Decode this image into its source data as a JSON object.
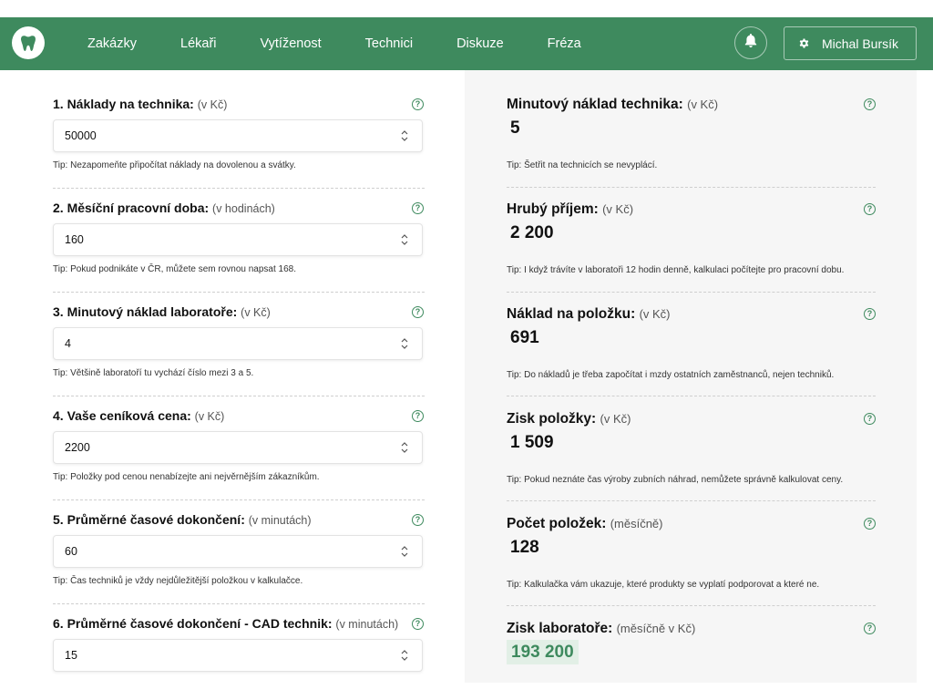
{
  "nav": {
    "items": [
      "Zakázky",
      "Lékaři",
      "Vytíženost",
      "Technici",
      "Diskuze",
      "Fréza"
    ],
    "user_name": "Michal Bursík",
    "accent": "#3e8a5e"
  },
  "tip_prefix": "Tip:",
  "help_glyph": "?",
  "inputs": [
    {
      "label": "1. Náklady na technika:",
      "unit": "(v Kč)",
      "value": "50000",
      "tip": "Nezapomeňte připočítat náklady na dovolenou a svátky."
    },
    {
      "label": "2. Měsíční pracovní doba:",
      "unit": "(v hodinách)",
      "value": "160",
      "tip": "Pokud podnikáte v ČR, můžete sem rovnou napsat 168."
    },
    {
      "label": "3. Minutový náklad laboratoře:",
      "unit": "(v Kč)",
      "value": "4",
      "tip": "Většině laboratoří tu vychází číslo mezi 3 a 5."
    },
    {
      "label": "4. Vaše ceníková cena:",
      "unit": "(v Kč)",
      "value": "2200",
      "tip": "Položky pod cenou nenabízejte ani nejvěrnějším zákazníkům."
    },
    {
      "label": "5. Průměrné časové dokončení:",
      "unit": "(v minutách)",
      "value": "60",
      "tip": "Čas techniků je vždy nejdůležitější položkou v kalkulačce."
    },
    {
      "label": "6. Průměrné časové dokončení - CAD technik:",
      "unit": "(v minutách)",
      "value": "15",
      "tip": ""
    }
  ],
  "results": [
    {
      "label": "Minutový náklad technika:",
      "unit": "(v Kč)",
      "value": "5",
      "tip": "Šetřit na technicích se nevyplácí."
    },
    {
      "label": "Hrubý příjem:",
      "unit": "(v Kč)",
      "value": "2 200",
      "tip": "I když trávíte v laboratoři 12 hodin denně, kalkulaci počítejte pro pracovní dobu."
    },
    {
      "label": "Náklad na položku:",
      "unit": "(v Kč)",
      "value": "691",
      "tip": "Do nákladů je třeba započítat i mzdy ostatních zaměstnanců, nejen techniků."
    },
    {
      "label": "Zisk položky:",
      "unit": "(v Kč)",
      "value": "1 509",
      "tip": "Pokud neznáte čas výroby zubních náhrad, nemůžete správně kalkulovat ceny."
    },
    {
      "label": "Počet položek:",
      "unit": "(měsíčně)",
      "value": "128",
      "tip": "Kalkulačka vám ukazuje, které produkty se vyplatí podporovat a které ne."
    },
    {
      "label": "Zisk laboratoře:",
      "unit": "(měsíčně v Kč)",
      "value": "193 200",
      "tip": ""
    }
  ]
}
